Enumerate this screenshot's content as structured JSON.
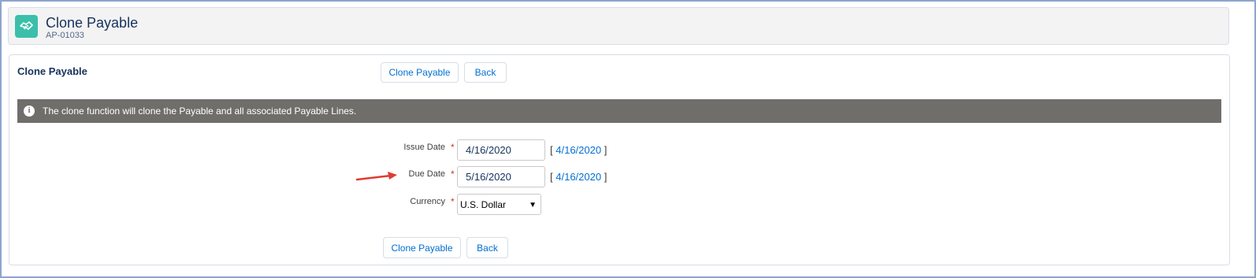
{
  "header": {
    "title": "Clone Payable",
    "subtitle": "AP-01033",
    "icon": "handshake-icon",
    "icon_color": "#3bbfaa"
  },
  "card": {
    "title": "Clone Payable",
    "top_buttons": {
      "clone": "Clone Payable",
      "back": "Back"
    },
    "bottom_buttons": {
      "clone": "Clone Payable",
      "back": "Back"
    }
  },
  "info": {
    "icon": "info-icon",
    "text": "The clone function will clone the Payable and all associated Payable Lines."
  },
  "form": {
    "issue_date": {
      "label": "Issue Date",
      "value": "4/16/2020",
      "link": "4/16/2020"
    },
    "due_date": {
      "label": "Due Date",
      "value": "5/16/2020",
      "link": "4/16/2020"
    },
    "currency": {
      "label": "Currency",
      "value": "U.S. Dollar"
    },
    "required_marker": "*",
    "bracket_open": "[",
    "bracket_close": "]"
  },
  "colors": {
    "brand_link": "#0070d2",
    "info_bar": "#706e6b",
    "required": "#c23934",
    "annotation_arrow": "#e03c31"
  }
}
